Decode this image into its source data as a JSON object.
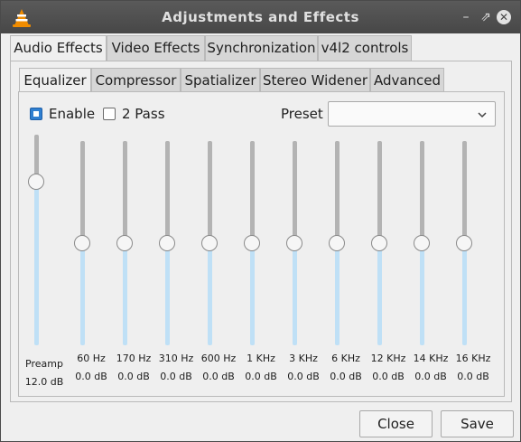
{
  "window": {
    "title": "Adjustments and Effects"
  },
  "main_tabs": [
    {
      "label": "Audio Effects"
    },
    {
      "label": "Video Effects"
    },
    {
      "label": "Synchronization"
    },
    {
      "label": "v4l2 controls"
    }
  ],
  "sub_tabs": [
    {
      "label": "Equalizer"
    },
    {
      "label": "Compressor"
    },
    {
      "label": "Spatializer"
    },
    {
      "label": "Stereo Widener"
    },
    {
      "label": "Advanced"
    }
  ],
  "equalizer": {
    "enable_label": "Enable",
    "enable_checked": true,
    "two_pass_label": "2 Pass",
    "two_pass_checked": false,
    "preset_label": "Preset",
    "preset_value": "",
    "preamp": {
      "label": "Preamp",
      "value": "12.0 dB",
      "level": 0.8
    },
    "bands": [
      {
        "freq": "60 Hz",
        "value": "0.0 dB",
        "level": 0.5
      },
      {
        "freq": "170 Hz",
        "value": "0.0 dB",
        "level": 0.5
      },
      {
        "freq": "310 Hz",
        "value": "0.0 dB",
        "level": 0.5
      },
      {
        "freq": "600 Hz",
        "value": "0.0 dB",
        "level": 0.5
      },
      {
        "freq": "1 KHz",
        "value": "0.0 dB",
        "level": 0.5
      },
      {
        "freq": "3 KHz",
        "value": "0.0 dB",
        "level": 0.5
      },
      {
        "freq": "6 KHz",
        "value": "0.0 dB",
        "level": 0.5
      },
      {
        "freq": "12 KHz",
        "value": "0.0 dB",
        "level": 0.5
      },
      {
        "freq": "14 KHz",
        "value": "0.0 dB",
        "level": 0.5
      },
      {
        "freq": "16 KHz",
        "value": "0.0 dB",
        "level": 0.5
      }
    ]
  },
  "buttons": {
    "close": "Close",
    "save": "Save"
  },
  "icons": {
    "app": "vlc-cone-icon",
    "minimize": "minimize-icon",
    "maximize": "maximize-icon",
    "close": "close-icon",
    "dropdown": "chevron-down-icon"
  }
}
